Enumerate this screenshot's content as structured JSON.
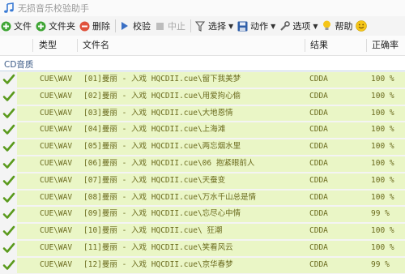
{
  "window": {
    "title": "无损音乐校验助手"
  },
  "toolbar": {
    "items": [
      {
        "label": "文件",
        "icon": "add-icon"
      },
      {
        "label": "文件夹",
        "icon": "add-folder-icon"
      },
      {
        "label": "删除",
        "icon": "remove-icon"
      },
      {
        "label": "校验",
        "icon": "play-icon"
      },
      {
        "label": "中止",
        "icon": "stop-icon",
        "disabled": true
      },
      {
        "label": "选择",
        "icon": "filter-icon"
      },
      {
        "label": "动作",
        "icon": "save-icon"
      },
      {
        "label": "选项",
        "icon": "wrench-icon"
      },
      {
        "label": "帮助",
        "icon": "lightbulb-icon"
      }
    ]
  },
  "table": {
    "headers": {
      "type": "类型",
      "filename": "文件名",
      "result": "结果",
      "rate": "正确率"
    },
    "group": "CD音质",
    "rows": [
      {
        "type": "CUE\\WAV",
        "name": "[01]曼丽 - 入戏 HQCDII.cue\\留下我美梦",
        "result": "CDDA",
        "rate": "100 %"
      },
      {
        "type": "CUE\\WAV",
        "name": "[02]曼丽 - 入戏 HQCDII.cue\\用爱拘心偷",
        "result": "CDDA",
        "rate": "100 %"
      },
      {
        "type": "CUE\\WAV",
        "name": "[03]曼丽 - 入戏 HQCDII.cue\\大地恩情",
        "result": "CDDA",
        "rate": "100 %"
      },
      {
        "type": "CUE\\WAV",
        "name": "[04]曼丽 - 入戏 HQCDII.cue\\上海滩",
        "result": "CDDA",
        "rate": "100 %"
      },
      {
        "type": "CUE\\WAV",
        "name": "[05]曼丽 - 入戏 HQCDII.cue\\两忘烟水里",
        "result": "CDDA",
        "rate": "100 %"
      },
      {
        "type": "CUE\\WAV",
        "name": "[06]曼丽 - 入戏 HQCDII.cue\\06 抱紧眼前人",
        "result": "CDDA",
        "rate": "100 %"
      },
      {
        "type": "CUE\\WAV",
        "name": "[07]曼丽 - 入戏 HQCDII.cue\\天蚕变",
        "result": "CDDA",
        "rate": "100 %"
      },
      {
        "type": "CUE\\WAV",
        "name": "[08]曼丽 - 入戏 HQCDII.cue\\万水千山总是情",
        "result": "CDDA",
        "rate": "100 %"
      },
      {
        "type": "CUE\\WAV",
        "name": "[09]曼丽 - 入戏 HQCDII.cue\\忘尽心中情",
        "result": "CDDA",
        "rate": "99 %"
      },
      {
        "type": "CUE\\WAV",
        "name": "[10]曼丽 - 入戏 HQCDII.cue\\ 狂潮",
        "result": "CDDA",
        "rate": "100 %"
      },
      {
        "type": "CUE\\WAV",
        "name": "[11]曼丽 - 入戏 HQCDII.cue\\笑看风云",
        "result": "CDDA",
        "rate": "100 %"
      },
      {
        "type": "CUE\\WAV",
        "name": "[12]曼丽 - 入戏 HQCDII.cue\\京华春梦",
        "result": "CDDA",
        "rate": "99 %"
      }
    ]
  },
  "colors": {
    "row_bg": "#eaf6c6",
    "row_text": "#6b6b1e",
    "check": "#5a9a1c",
    "group_text": "#3b5a86"
  }
}
